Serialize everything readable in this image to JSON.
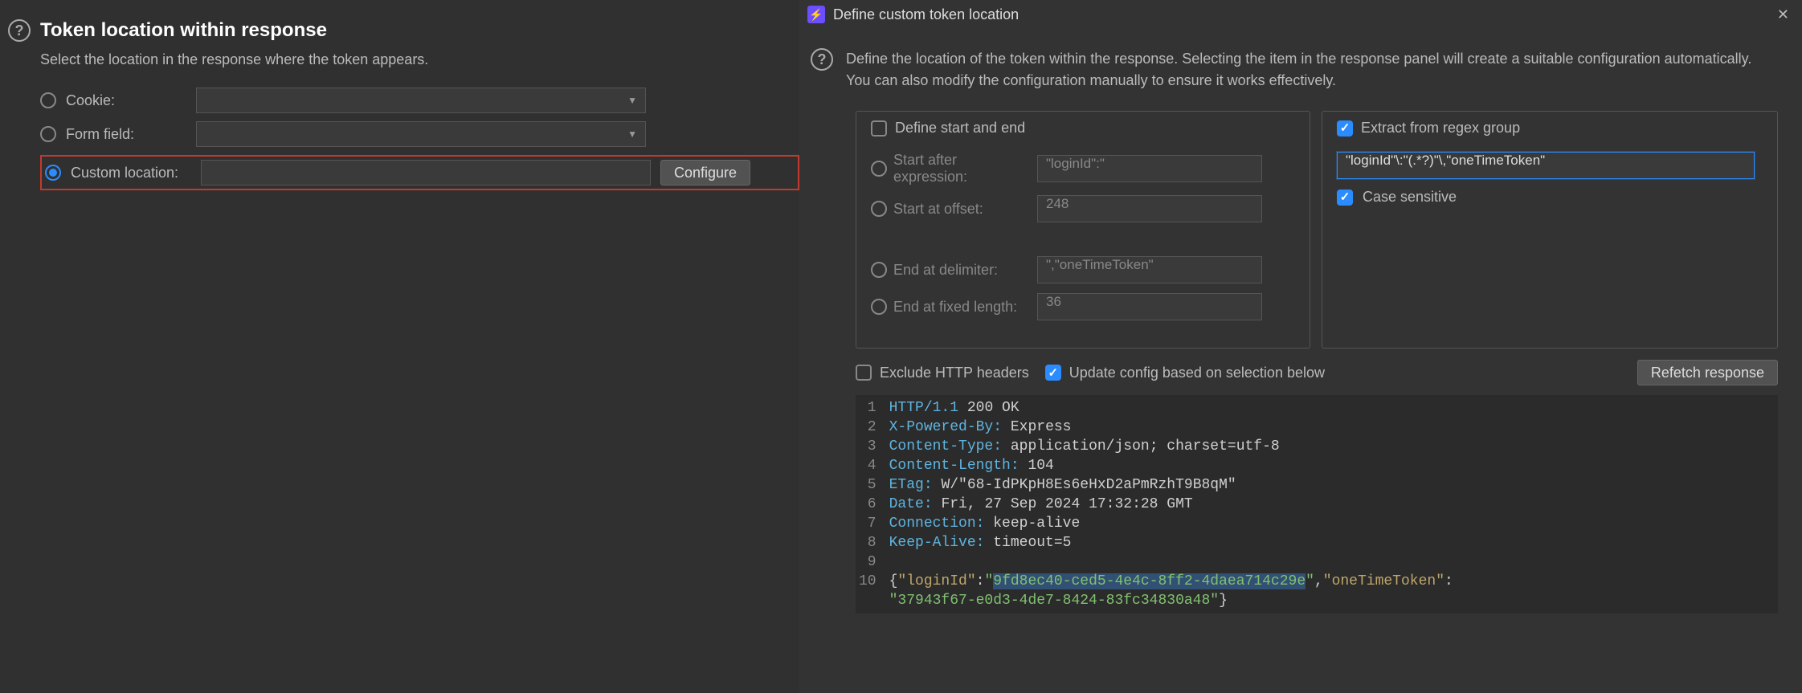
{
  "left": {
    "title": "Token location within response",
    "description": "Select the location in the response where the token appears.",
    "options": {
      "cookie": {
        "label": "Cookie:"
      },
      "form_field": {
        "label": "Form field:"
      },
      "custom": {
        "label": "Custom location:",
        "configure_btn": "Configure"
      }
    }
  },
  "right": {
    "window_title": "Define custom token location",
    "description": "Define the location of the token within the response. Selecting the item in the response panel will create a suitable configuration automatically. You can also modify the configuration manually to ensure it works effectively.",
    "define_start_end": {
      "legend": "Define start and end",
      "start_after_expression": {
        "label": "Start after expression:",
        "value": "\"loginId\":\""
      },
      "start_at_offset": {
        "label": "Start at offset:",
        "value": "248"
      },
      "end_at_delimiter": {
        "label": "End at delimiter:",
        "value": "\",\"oneTimeToken\""
      },
      "end_at_fixed_length": {
        "label": "End at fixed length:",
        "value": "36"
      }
    },
    "regex_group": {
      "legend": "Extract from regex group",
      "value": "\"loginId\"\\:\"(.*?)\"\\,\"oneTimeToken\"",
      "case_sensitive_label": "Case sensitive"
    },
    "exclude_headers_label": "Exclude HTTP headers",
    "update_config_label": "Update config based on selection below",
    "refetch_btn": "Refetch response",
    "response": {
      "lines": [
        {
          "n": "1",
          "key": "HTTP/1.1",
          "val": "200 OK"
        },
        {
          "n": "2",
          "key": "X-Powered-By:",
          "val": "Express"
        },
        {
          "n": "3",
          "key": "Content-Type:",
          "val": "application/json; charset=utf-8"
        },
        {
          "n": "4",
          "key": "Content-Length:",
          "val": "104"
        },
        {
          "n": "5",
          "key": "ETag:",
          "val": "W/\"68-IdPKpH8Es6eHxD2aPmRzhT9B8qM\""
        },
        {
          "n": "6",
          "key": "Date:",
          "val": "Fri, 27 Sep 2024 17:32:28 GMT"
        },
        {
          "n": "7",
          "key": "Connection:",
          "val": "keep-alive"
        },
        {
          "n": "8",
          "key": "Keep-Alive:",
          "val": "timeout=5"
        },
        {
          "n": "9"
        },
        {
          "n": "10"
        }
      ],
      "body": {
        "open": "{",
        "k1": "\"loginId\"",
        "colon": ":",
        "v1_q1": "\"",
        "v1_guid": "9fd8ec40-ced5-4e4c-8ff2-4daea714c29e",
        "v1_q2": "\"",
        "comma": ",",
        "k2": "\"oneTimeToken\"",
        "v2": "\"37943f67-e0d3-4de7-8424-83fc34830a48\"",
        "close": "}"
      }
    }
  }
}
